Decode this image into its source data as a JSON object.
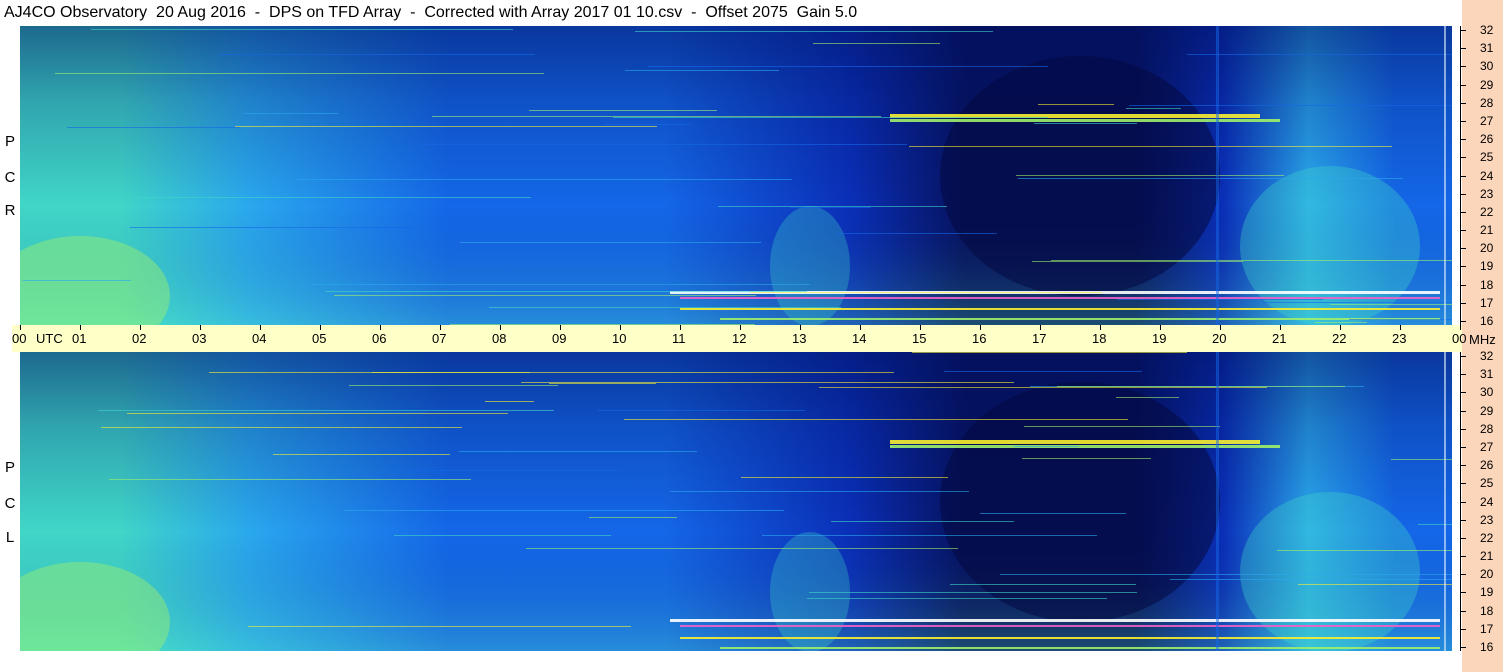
{
  "window": {
    "title": "AJ4CO Observatory  20 Aug 2016  -  DPS on TFD Array  -  Corrected with Array 2017 01 10.csv  -  Offset 2075  Gain 5.0"
  },
  "panels": [
    {
      "id": "rcp",
      "label_letters": [
        "P",
        "C",
        "R"
      ]
    },
    {
      "id": "lcp",
      "label_letters": [
        "P",
        "C",
        "L"
      ]
    }
  ],
  "chart_data": {
    "type": "heatmap",
    "x": {
      "unit": "UTC",
      "tick_labels": [
        "00",
        "01",
        "02",
        "03",
        "04",
        "05",
        "06",
        "07",
        "08",
        "09",
        "10",
        "11",
        "12",
        "13",
        "14",
        "15",
        "16",
        "17",
        "18",
        "19",
        "20",
        "21",
        "22",
        "23",
        "00"
      ],
      "range": [
        0,
        24
      ]
    },
    "y": {
      "unit": "MHz",
      "tick_labels": [
        "32",
        "31",
        "30",
        "29",
        "28",
        "27",
        "26",
        "25",
        "24",
        "23",
        "22",
        "21",
        "20",
        "19",
        "18",
        "17",
        "16"
      ],
      "range": [
        16,
        32
      ]
    },
    "colormap": [
      "#06125e",
      "#0a2fb8",
      "#1467e8",
      "#2aa8ee",
      "#40d6c8",
      "#9ef06a",
      "#f8f030",
      "#f060c8",
      "#ffffff"
    ],
    "series": [
      {
        "name": "R C P",
        "label": "RCP"
      },
      {
        "name": "L C P",
        "label": "LCP"
      }
    ]
  },
  "axis": {
    "utc_label": "UTC",
    "mhz_label": "MHz"
  }
}
